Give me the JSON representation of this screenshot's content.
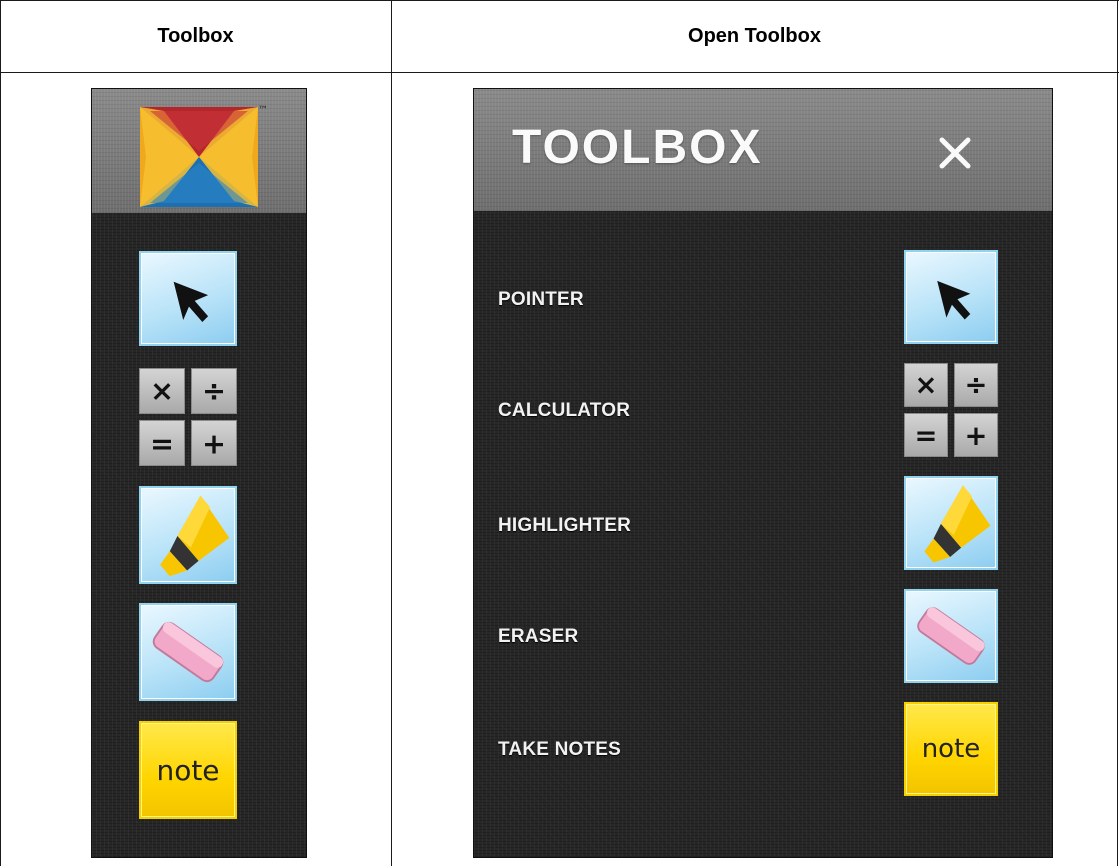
{
  "table": {
    "col_left_header": "Toolbox",
    "col_right_header": "Open Toolbox"
  },
  "open_toolbox": {
    "title": "TOOLBOX",
    "close_glyph": "×",
    "tools": [
      {
        "label": "POINTER",
        "icon": "pointer-arrow-icon"
      },
      {
        "label": "CALCULATOR",
        "icon": "calculator-icon"
      },
      {
        "label": "HIGHLIGHTER",
        "icon": "highlighter-icon"
      },
      {
        "label": "ERASER",
        "icon": "eraser-icon"
      },
      {
        "label": "TAKE NOTES",
        "icon": "note-icon"
      }
    ]
  },
  "note_label": "note",
  "calculator_keys": [
    "×",
    "÷",
    "=",
    "+"
  ],
  "logo_trademark": "™",
  "colors": {
    "panel_dark": "#262626",
    "panel_header": "#7c7c7c",
    "tile_blue": "#b9e3f8",
    "note_yellow": "#ffd500",
    "highlighter_yellow": "#f7c600",
    "eraser_pink": "#f2a8c8"
  }
}
